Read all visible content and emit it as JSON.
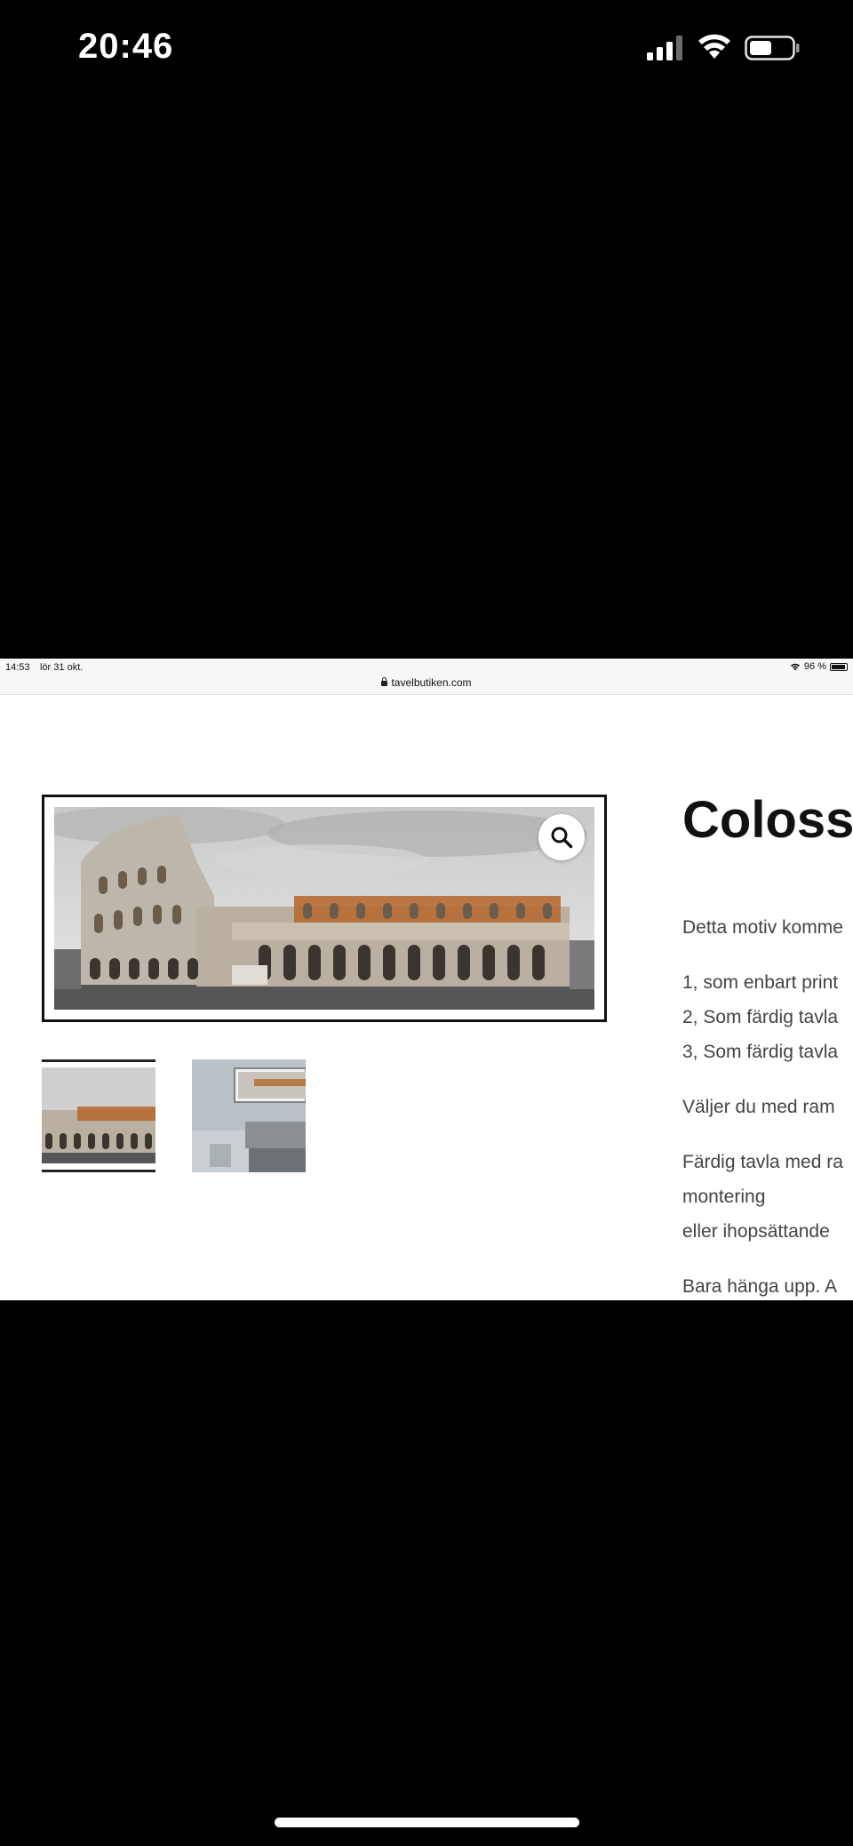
{
  "phone_status": {
    "time": "20:46"
  },
  "ipad_status": {
    "time": "14:53",
    "date": "lör 31 okt.",
    "url": "tavelbutiken.com",
    "battery": "96 %"
  },
  "product": {
    "title": "Coloss",
    "description_lines": [
      "Detta motiv komme",
      "1, som enbart print",
      "2, Som färdig tavla",
      "3, Som färdig tavla",
      "Väljer du med ram",
      "Färdig tavla med ra",
      "montering",
      "eller ihopsättande",
      "Bara hänga upp. A"
    ]
  },
  "icons": {
    "zoom": "search-icon",
    "lock": "lock-icon",
    "wifi": "wifi-icon",
    "battery": "battery-icon",
    "signal": "signal-icon"
  }
}
